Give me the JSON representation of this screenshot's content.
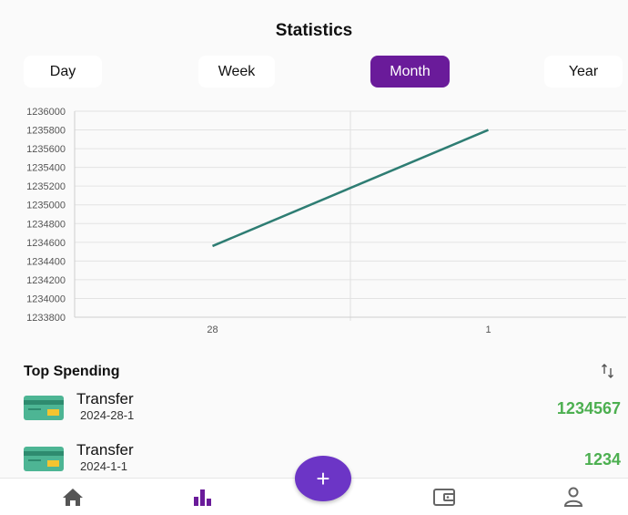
{
  "header": {
    "title": "Statistics"
  },
  "tabs": [
    {
      "label": "Day",
      "active": false
    },
    {
      "label": "Week",
      "active": false
    },
    {
      "label": "Month",
      "active": true
    },
    {
      "label": "Year",
      "active": false
    }
  ],
  "colors": {
    "accent": "#6a1b9a",
    "fab": "#6c35c6",
    "line": "#2e7d73",
    "amount": "#4caf50"
  },
  "chart_data": {
    "type": "line",
    "x": [
      "28",
      "1"
    ],
    "series": [
      {
        "values": [
          1234560,
          1235800
        ]
      }
    ],
    "ylim": [
      1233800,
      1236000
    ],
    "yticks": [
      "1236000",
      "1235800",
      "1235600",
      "1235400",
      "1235200",
      "1235000",
      "1234800",
      "1234600",
      "1234400",
      "1234200",
      "1234000",
      "1233800"
    ],
    "grid": true
  },
  "top_spending": {
    "title": "Top Spending",
    "sort_icon": "sort-icon",
    "items": [
      {
        "name": "Transfer",
        "date": "2024-28-1",
        "amount": "1234567",
        "icon": "credit-card-icon"
      },
      {
        "name": "Transfer",
        "date": "2024-1-1",
        "amount": "1234",
        "icon": "credit-card-icon"
      }
    ]
  },
  "fab": {
    "label": "+"
  },
  "nav": [
    {
      "icon": "home-icon"
    },
    {
      "icon": "bar-chart-icon"
    },
    {
      "icon": "wallet-icon"
    },
    {
      "icon": "user-icon"
    }
  ]
}
